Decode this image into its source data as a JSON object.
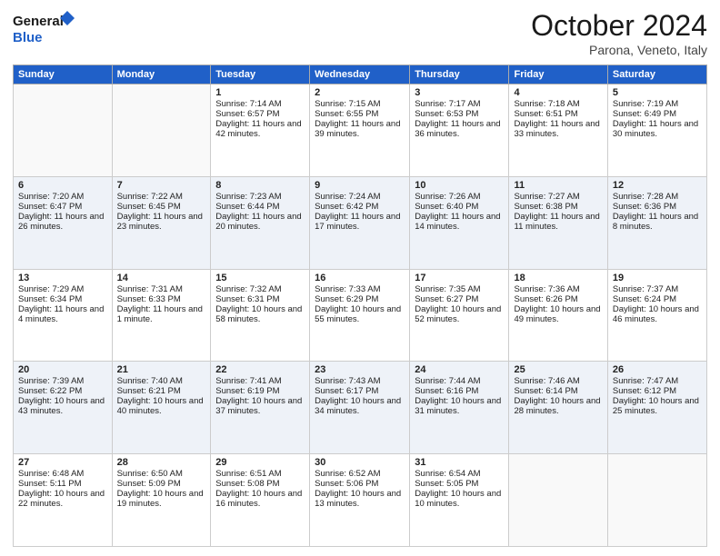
{
  "header": {
    "logo_line1": "General",
    "logo_line2": "Blue",
    "month": "October 2024",
    "location": "Parona, Veneto, Italy"
  },
  "days_of_week": [
    "Sunday",
    "Monday",
    "Tuesday",
    "Wednesday",
    "Thursday",
    "Friday",
    "Saturday"
  ],
  "weeks": [
    [
      {
        "day": "",
        "sunrise": "",
        "sunset": "",
        "daylight": ""
      },
      {
        "day": "",
        "sunrise": "",
        "sunset": "",
        "daylight": ""
      },
      {
        "day": "1",
        "sunrise": "Sunrise: 7:14 AM",
        "sunset": "Sunset: 6:57 PM",
        "daylight": "Daylight: 11 hours and 42 minutes."
      },
      {
        "day": "2",
        "sunrise": "Sunrise: 7:15 AM",
        "sunset": "Sunset: 6:55 PM",
        "daylight": "Daylight: 11 hours and 39 minutes."
      },
      {
        "day": "3",
        "sunrise": "Sunrise: 7:17 AM",
        "sunset": "Sunset: 6:53 PM",
        "daylight": "Daylight: 11 hours and 36 minutes."
      },
      {
        "day": "4",
        "sunrise": "Sunrise: 7:18 AM",
        "sunset": "Sunset: 6:51 PM",
        "daylight": "Daylight: 11 hours and 33 minutes."
      },
      {
        "day": "5",
        "sunrise": "Sunrise: 7:19 AM",
        "sunset": "Sunset: 6:49 PM",
        "daylight": "Daylight: 11 hours and 30 minutes."
      }
    ],
    [
      {
        "day": "6",
        "sunrise": "Sunrise: 7:20 AM",
        "sunset": "Sunset: 6:47 PM",
        "daylight": "Daylight: 11 hours and 26 minutes."
      },
      {
        "day": "7",
        "sunrise": "Sunrise: 7:22 AM",
        "sunset": "Sunset: 6:45 PM",
        "daylight": "Daylight: 11 hours and 23 minutes."
      },
      {
        "day": "8",
        "sunrise": "Sunrise: 7:23 AM",
        "sunset": "Sunset: 6:44 PM",
        "daylight": "Daylight: 11 hours and 20 minutes."
      },
      {
        "day": "9",
        "sunrise": "Sunrise: 7:24 AM",
        "sunset": "Sunset: 6:42 PM",
        "daylight": "Daylight: 11 hours and 17 minutes."
      },
      {
        "day": "10",
        "sunrise": "Sunrise: 7:26 AM",
        "sunset": "Sunset: 6:40 PM",
        "daylight": "Daylight: 11 hours and 14 minutes."
      },
      {
        "day": "11",
        "sunrise": "Sunrise: 7:27 AM",
        "sunset": "Sunset: 6:38 PM",
        "daylight": "Daylight: 11 hours and 11 minutes."
      },
      {
        "day": "12",
        "sunrise": "Sunrise: 7:28 AM",
        "sunset": "Sunset: 6:36 PM",
        "daylight": "Daylight: 11 hours and 8 minutes."
      }
    ],
    [
      {
        "day": "13",
        "sunrise": "Sunrise: 7:29 AM",
        "sunset": "Sunset: 6:34 PM",
        "daylight": "Daylight: 11 hours and 4 minutes."
      },
      {
        "day": "14",
        "sunrise": "Sunrise: 7:31 AM",
        "sunset": "Sunset: 6:33 PM",
        "daylight": "Daylight: 11 hours and 1 minute."
      },
      {
        "day": "15",
        "sunrise": "Sunrise: 7:32 AM",
        "sunset": "Sunset: 6:31 PM",
        "daylight": "Daylight: 10 hours and 58 minutes."
      },
      {
        "day": "16",
        "sunrise": "Sunrise: 7:33 AM",
        "sunset": "Sunset: 6:29 PM",
        "daylight": "Daylight: 10 hours and 55 minutes."
      },
      {
        "day": "17",
        "sunrise": "Sunrise: 7:35 AM",
        "sunset": "Sunset: 6:27 PM",
        "daylight": "Daylight: 10 hours and 52 minutes."
      },
      {
        "day": "18",
        "sunrise": "Sunrise: 7:36 AM",
        "sunset": "Sunset: 6:26 PM",
        "daylight": "Daylight: 10 hours and 49 minutes."
      },
      {
        "day": "19",
        "sunrise": "Sunrise: 7:37 AM",
        "sunset": "Sunset: 6:24 PM",
        "daylight": "Daylight: 10 hours and 46 minutes."
      }
    ],
    [
      {
        "day": "20",
        "sunrise": "Sunrise: 7:39 AM",
        "sunset": "Sunset: 6:22 PM",
        "daylight": "Daylight: 10 hours and 43 minutes."
      },
      {
        "day": "21",
        "sunrise": "Sunrise: 7:40 AM",
        "sunset": "Sunset: 6:21 PM",
        "daylight": "Daylight: 10 hours and 40 minutes."
      },
      {
        "day": "22",
        "sunrise": "Sunrise: 7:41 AM",
        "sunset": "Sunset: 6:19 PM",
        "daylight": "Daylight: 10 hours and 37 minutes."
      },
      {
        "day": "23",
        "sunrise": "Sunrise: 7:43 AM",
        "sunset": "Sunset: 6:17 PM",
        "daylight": "Daylight: 10 hours and 34 minutes."
      },
      {
        "day": "24",
        "sunrise": "Sunrise: 7:44 AM",
        "sunset": "Sunset: 6:16 PM",
        "daylight": "Daylight: 10 hours and 31 minutes."
      },
      {
        "day": "25",
        "sunrise": "Sunrise: 7:46 AM",
        "sunset": "Sunset: 6:14 PM",
        "daylight": "Daylight: 10 hours and 28 minutes."
      },
      {
        "day": "26",
        "sunrise": "Sunrise: 7:47 AM",
        "sunset": "Sunset: 6:12 PM",
        "daylight": "Daylight: 10 hours and 25 minutes."
      }
    ],
    [
      {
        "day": "27",
        "sunrise": "Sunrise: 6:48 AM",
        "sunset": "Sunset: 5:11 PM",
        "daylight": "Daylight: 10 hours and 22 minutes."
      },
      {
        "day": "28",
        "sunrise": "Sunrise: 6:50 AM",
        "sunset": "Sunset: 5:09 PM",
        "daylight": "Daylight: 10 hours and 19 minutes."
      },
      {
        "day": "29",
        "sunrise": "Sunrise: 6:51 AM",
        "sunset": "Sunset: 5:08 PM",
        "daylight": "Daylight: 10 hours and 16 minutes."
      },
      {
        "day": "30",
        "sunrise": "Sunrise: 6:52 AM",
        "sunset": "Sunset: 5:06 PM",
        "daylight": "Daylight: 10 hours and 13 minutes."
      },
      {
        "day": "31",
        "sunrise": "Sunrise: 6:54 AM",
        "sunset": "Sunset: 5:05 PM",
        "daylight": "Daylight: 10 hours and 10 minutes."
      },
      {
        "day": "",
        "sunrise": "",
        "sunset": "",
        "daylight": ""
      },
      {
        "day": "",
        "sunrise": "",
        "sunset": "",
        "daylight": ""
      }
    ]
  ]
}
